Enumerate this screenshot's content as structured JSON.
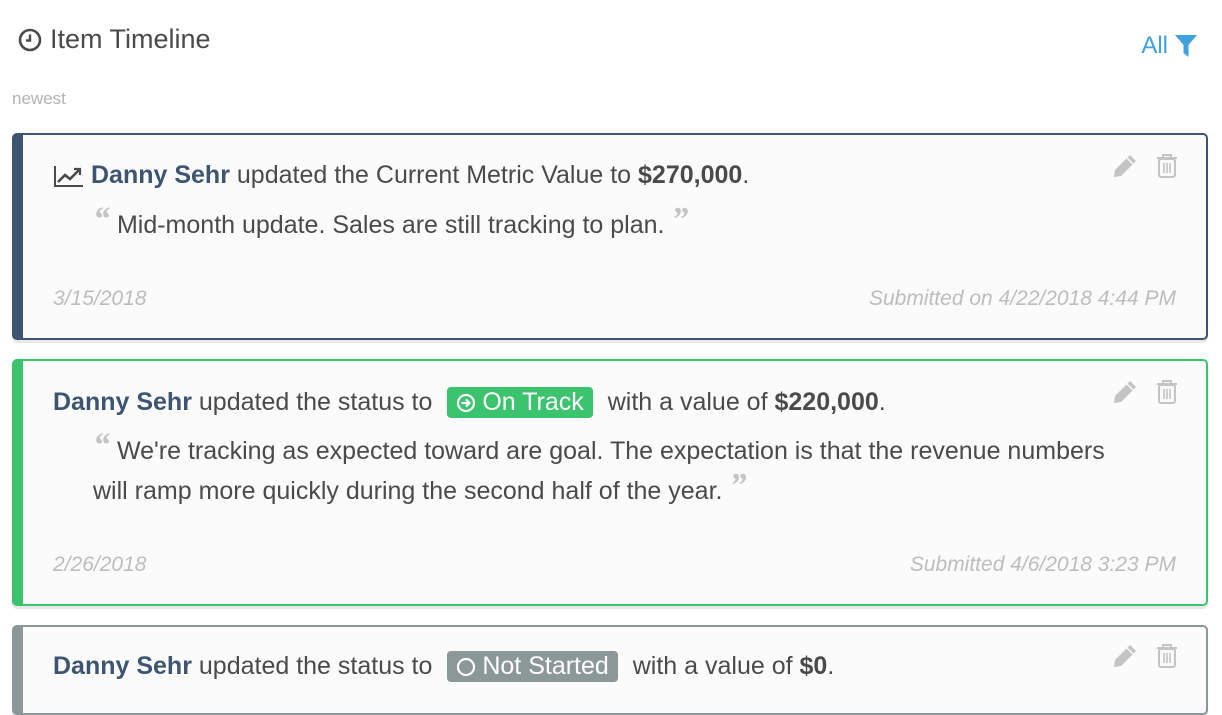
{
  "header": {
    "title": "Item Timeline",
    "icon": "clock-icon",
    "filter_label": "All",
    "filter_icon": "filter-icon"
  },
  "sort_label": "newest",
  "colors": {
    "accent": "#3ea1e0",
    "user_name": "#3d5570",
    "metric_card": "#3d5570",
    "on_track": "#3cc36e",
    "not_started": "#8c9798"
  },
  "entries": [
    {
      "type": "metric",
      "icon": "line-chart-icon",
      "user": "Danny Sehr",
      "text_before": " updated the Current Metric Value to ",
      "value": "$270,000",
      "text_after": ".",
      "comment": "Mid-month update. Sales are still tracking to plan.",
      "date": "3/15/2018",
      "submitted": "Submitted on 4/22/2018 4:44 PM"
    },
    {
      "type": "status",
      "user": "Danny Sehr",
      "text_before": " updated the status to ",
      "status_label": "On Track",
      "status_icon": "arrow-circle-right-icon",
      "text_mid": " with a value of ",
      "value": "$220,000",
      "text_after": ".",
      "comment": "We're tracking as expected toward are goal. The expectation is that the revenue numbers will ramp more quickly during the second half of the year.",
      "date": "2/26/2018",
      "submitted": "Submitted 4/6/2018 3:23 PM"
    },
    {
      "type": "status",
      "user": "Danny Sehr",
      "text_before": " updated the status to ",
      "status_label": "Not Started",
      "status_icon": "circle-outline-icon",
      "text_mid": " with a value of ",
      "value": "$0",
      "text_after": "."
    }
  ],
  "actions": {
    "edit_icon": "pencil-icon",
    "delete_icon": "trash-icon"
  }
}
